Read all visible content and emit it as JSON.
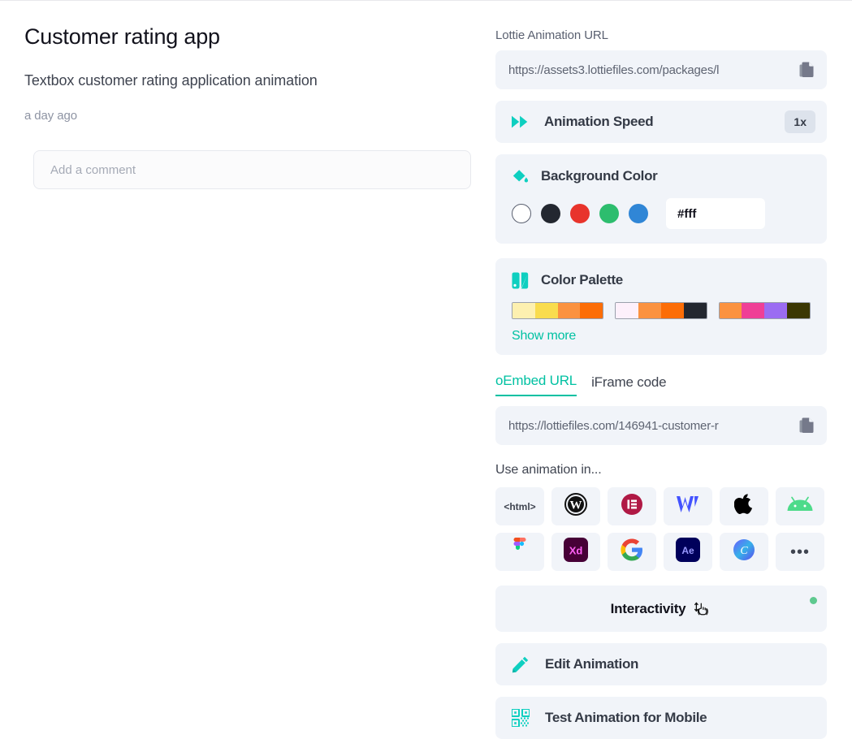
{
  "animation": {
    "title": "Customer rating app",
    "description": "Textbox customer rating application animation",
    "timestamp": "a day ago"
  },
  "comment": {
    "placeholder": "Add a comment",
    "value": ""
  },
  "lottie_url": {
    "label": "Lottie Animation URL",
    "value": "https://assets3.lottiefiles.com/packages/l",
    "copy_icon": "copy-icon"
  },
  "speed": {
    "icon": "fast-forward-icon",
    "label": "Animation Speed",
    "value": "1x"
  },
  "background_color": {
    "icon": "paint-bucket-icon",
    "label": "Background Color",
    "hex_value": "#fff",
    "swatches": [
      {
        "name": "white",
        "hex": "#ffffff",
        "selected": true
      },
      {
        "name": "dark",
        "hex": "#232730",
        "selected": false
      },
      {
        "name": "red",
        "hex": "#e8342c",
        "selected": false
      },
      {
        "name": "green",
        "hex": "#2dbd6e",
        "selected": false
      },
      {
        "name": "blue",
        "hex": "#3086d6",
        "selected": false
      }
    ]
  },
  "color_palette": {
    "icon": "color-palette-icon",
    "label": "Color Palette",
    "show_more_label": "Show more",
    "palettes": [
      [
        "#fdf0b0",
        "#f9dc4e",
        "#fb9240",
        "#fc6d07"
      ],
      [
        "#fdf0fb",
        "#fb9240",
        "#fc6d07",
        "#232730"
      ],
      [
        "#fb9240",
        "#ef3f96",
        "#9b6cf2",
        "#3b3703"
      ]
    ]
  },
  "embed": {
    "tabs": [
      {
        "label": "oEmbed URL",
        "active": true
      },
      {
        "label": "iFrame code",
        "active": false
      }
    ],
    "url_value": "https://lottiefiles.com/146941-customer-r",
    "copy_icon": "copy-icon"
  },
  "use_animation": {
    "label": "Use animation in...",
    "apps": [
      {
        "name": "html",
        "icon": "html-icon",
        "text": "<html>"
      },
      {
        "name": "wordpress",
        "icon": "wordpress-icon"
      },
      {
        "name": "elementor",
        "icon": "elementor-icon"
      },
      {
        "name": "webflow",
        "icon": "webflow-icon"
      },
      {
        "name": "apple",
        "icon": "apple-icon"
      },
      {
        "name": "android",
        "icon": "android-icon"
      },
      {
        "name": "figma",
        "icon": "figma-icon"
      },
      {
        "name": "adobe-xd",
        "icon": "adobe-xd-icon"
      },
      {
        "name": "google",
        "icon": "google-icon"
      },
      {
        "name": "after-effects",
        "icon": "after-effects-icon"
      },
      {
        "name": "canva",
        "icon": "canva-icon"
      },
      {
        "name": "more",
        "icon": "more-dots-icon",
        "text": "•••"
      }
    ]
  },
  "interactivity": {
    "label": "Interactivity",
    "icon": "hand-gesture-icon",
    "status_dot_color": "#5ec98f"
  },
  "actions": [
    {
      "label": "Edit Animation",
      "icon": "pencil-icon"
    },
    {
      "label": "Test Animation for Mobile",
      "icon": "qr-code-icon"
    }
  ],
  "theme": {
    "accent": "#00c1a2",
    "card_bg": "#f1f4f9",
    "text_dark": "#343a46"
  }
}
